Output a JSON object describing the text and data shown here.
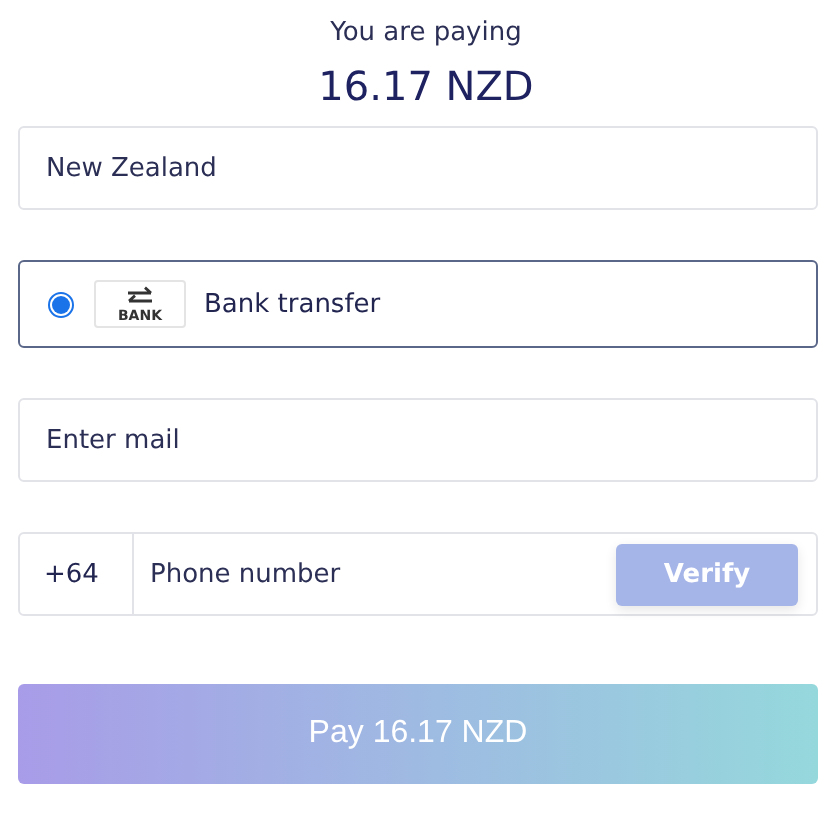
{
  "heading": "You are paying",
  "amount": "16.17 NZD",
  "country": {
    "value": "New Zealand"
  },
  "payment_methods": [
    {
      "label": "Bank transfer",
      "icon_label": "BANK",
      "selected": true
    }
  ],
  "email": {
    "placeholder": "Enter mail"
  },
  "phone": {
    "prefix": "+64",
    "placeholder": "Phone number",
    "verify": {
      "label": "Verify",
      "disabled": true
    }
  },
  "pay_button": {
    "label": "Pay 16.17 NZD"
  }
}
